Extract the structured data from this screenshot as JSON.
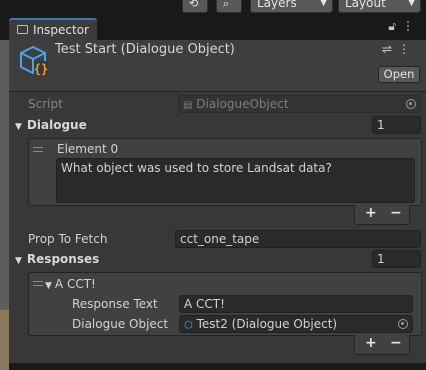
{
  "toolbar": {
    "layers_label": "Layers",
    "layout_label": "Layout"
  },
  "tab": {
    "label": "Inspector"
  },
  "header": {
    "title": "Test Start (Dialogue Object)",
    "open_label": "Open"
  },
  "script": {
    "label": "Script",
    "value": "DialogueObject"
  },
  "dialogue": {
    "label": "Dialogue",
    "count": "1",
    "element_label": "Element 0",
    "element_text": "What object was used to store Landsat data?"
  },
  "prop_to_fetch": {
    "label": "Prop To Fetch",
    "value": "cct_one_tape"
  },
  "responses": {
    "label": "Responses",
    "count": "1",
    "item_label": "A CCT!",
    "response_text_label": "Response Text",
    "response_text_value": "A CCT!",
    "dialogue_object_label": "Dialogue Object",
    "dialogue_object_value": "Test2 (Dialogue Object)"
  },
  "list_controls": {
    "plus": "+",
    "minus": "−"
  },
  "colors": {
    "accent_tab": "#3a79bb",
    "object_icon": "#4aa3e8",
    "object_icon_brace": "#f0a030"
  }
}
